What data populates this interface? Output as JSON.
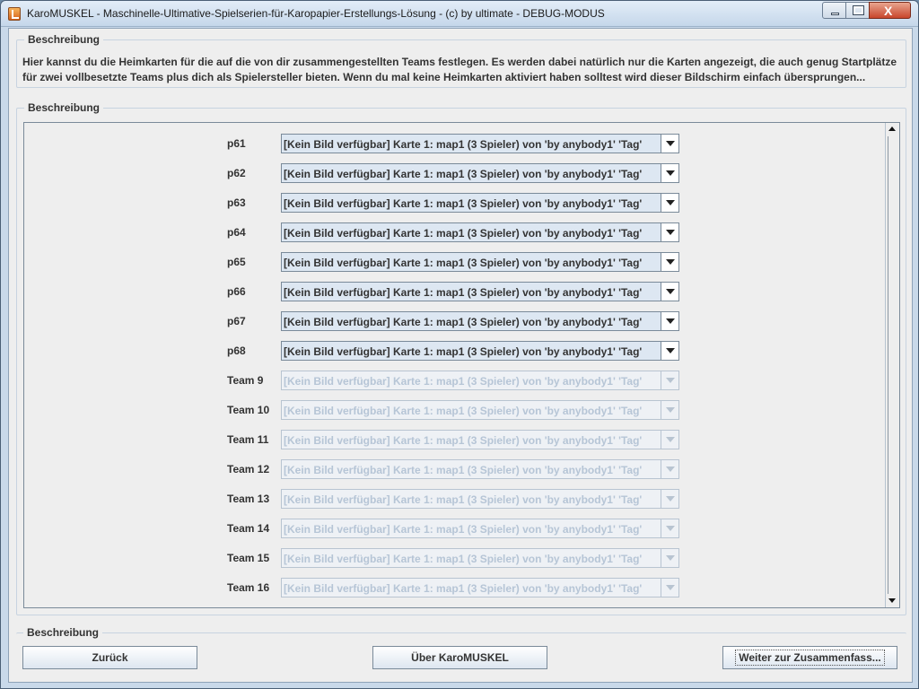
{
  "window": {
    "title": "KaroMUSKEL - Maschinelle-Ultimative-Spielserien-für-Karopapier-Erstellungs-Lösung - (c) by ultimate - DEBUG-MODUS",
    "close_glyph": "X"
  },
  "description_group": {
    "title": "Beschreibung",
    "text": "Hier kannst du die Heimkarten für die auf die von dir zusammengestellten Teams festlegen. Es werden dabei natürlich nur die Karten angezeigt, die auch genug Startplätze für zwei vollbesetzte Teams plus dich als Spielersteller bieten. Wenn du mal keine Heimkarten aktiviert haben solltest wird dieser Bildschirm einfach übersprungen..."
  },
  "teams_group": {
    "title": "Beschreibung",
    "rows": [
      {
        "label": "p61",
        "value": "[Kein Bild verfügbar] Karte 1: map1 (3 Spieler) von 'by anybody1' 'Tag'"
      },
      {
        "label": "p62",
        "value": "[Kein Bild verfügbar] Karte 1: map1 (3 Spieler) von 'by anybody1' 'Tag'"
      },
      {
        "label": "p63",
        "value": "[Kein Bild verfügbar] Karte 1: map1 (3 Spieler) von 'by anybody1' 'Tag'"
      },
      {
        "label": "p64",
        "value": "[Kein Bild verfügbar] Karte 1: map1 (3 Spieler) von 'by anybody1' 'Tag'"
      },
      {
        "label": "p65",
        "value": "[Kein Bild verfügbar] Karte 1: map1 (3 Spieler) von 'by anybody1' 'Tag'"
      },
      {
        "label": "p66",
        "value": "[Kein Bild verfügbar] Karte 1: map1 (3 Spieler) von 'by anybody1' 'Tag'"
      },
      {
        "label": "p67",
        "value": "[Kein Bild verfügbar] Karte 1: map1 (3 Spieler) von 'by anybody1' 'Tag'"
      },
      {
        "label": "p68",
        "value": "[Kein Bild verfügbar] Karte 1: map1 (3 Spieler) von 'by anybody1' 'Tag'"
      },
      {
        "label": "Team 9",
        "value": "[Kein Bild verfügbar] Karte 1: map1 (3 Spieler) von 'by anybody1' 'Tag'"
      },
      {
        "label": "Team 10",
        "value": "[Kein Bild verfügbar] Karte 1: map1 (3 Spieler) von 'by anybody1' 'Tag'"
      },
      {
        "label": "Team 11",
        "value": "[Kein Bild verfügbar] Karte 1: map1 (3 Spieler) von 'by anybody1' 'Tag'"
      },
      {
        "label": "Team 12",
        "value": "[Kein Bild verfügbar] Karte 1: map1 (3 Spieler) von 'by anybody1' 'Tag'"
      },
      {
        "label": "Team 13",
        "value": "[Kein Bild verfügbar] Karte 1: map1 (3 Spieler) von 'by anybody1' 'Tag'"
      },
      {
        "label": "Team 14",
        "value": "[Kein Bild verfügbar] Karte 1: map1 (3 Spieler) von 'by anybody1' 'Tag'"
      },
      {
        "label": "Team 15",
        "value": "[Kein Bild verfügbar] Karte 1: map1 (3 Spieler) von 'by anybody1' 'Tag'"
      },
      {
        "label": "Team 16",
        "value": "[Kein Bild verfügbar] Karte 1: map1 (3 Spieler) von 'by anybody1' 'Tag'"
      }
    ]
  },
  "footer_group": {
    "title": "Beschreibung",
    "back_label": "Zurück",
    "about_label": "Über KaroMUSKEL",
    "next_label": "Weiter zur Zusammenfass..."
  }
}
